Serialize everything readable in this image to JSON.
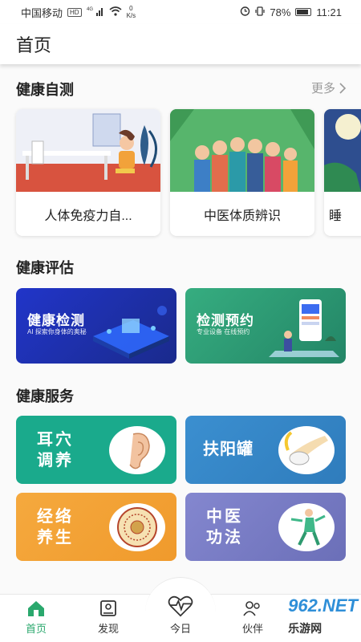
{
  "status_bar": {
    "carrier": "中国移动",
    "hd": "HD",
    "network": "4G",
    "speed_value": "0",
    "speed_unit": "K/s",
    "battery": "78%",
    "time": "11:21"
  },
  "header": {
    "title": "首页"
  },
  "self_test": {
    "title": "健康自测",
    "more": "更多",
    "cards": [
      {
        "label": "人体免疫力自..."
      },
      {
        "label": "中医体质辨识"
      },
      {
        "label": "睡"
      }
    ]
  },
  "assessment": {
    "title": "健康评估",
    "banners": [
      {
        "title": "健康检测",
        "subtitle": "AI 探索你身体的奥秘",
        "color": "#1d3bb3"
      },
      {
        "title": "检测预约",
        "subtitle": "专业设备  在线预约",
        "color": "#2a9a74"
      }
    ]
  },
  "services": {
    "title": "健康服务",
    "tiles": [
      {
        "line1": "耳穴",
        "line2": "调养",
        "color": "#1aaa8c",
        "icon": "ear-icon"
      },
      {
        "line1": "扶阳罐",
        "line2": "",
        "color": "#3a8fc7",
        "icon": "cupping-icon"
      },
      {
        "line1": "经络",
        "line2": "养生",
        "color": "#f2a43c",
        "icon": "meridian-wheel-icon"
      },
      {
        "line1": "中医",
        "line2": "功法",
        "color": "#7c7fc4",
        "icon": "taichi-figure-icon"
      }
    ]
  },
  "tabbar": {
    "tabs": [
      {
        "label": "首页",
        "icon": "home-icon"
      },
      {
        "label": "发现",
        "icon": "discover-icon"
      },
      {
        "label": "今日",
        "icon": "heartbeat-icon"
      },
      {
        "label": "伙伴",
        "icon": "partner-icon"
      }
    ]
  },
  "watermark": {
    "brand": "962.NET",
    "sub": "乐游网"
  },
  "colors": {
    "accent": "#2aa86d"
  }
}
